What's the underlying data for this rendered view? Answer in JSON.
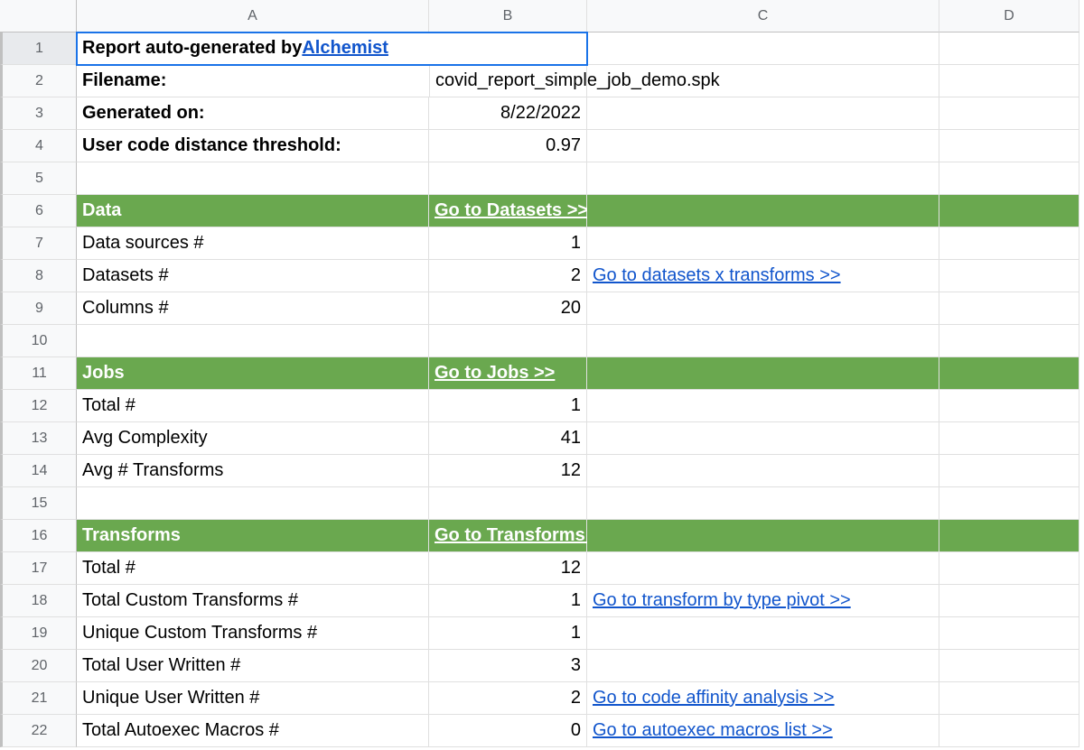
{
  "columns": [
    "A",
    "B",
    "C",
    "D"
  ],
  "row_numbers": [
    1,
    2,
    3,
    4,
    5,
    6,
    7,
    8,
    9,
    10,
    11,
    12,
    13,
    14,
    15,
    16,
    17,
    18,
    19,
    20,
    21,
    22
  ],
  "header": {
    "title_prefix": "Report auto-generated by ",
    "title_link": "Alchemist",
    "filename_label": "Filename:",
    "filename_value": "covid_report_simple_job_demo.spk",
    "generated_label": "Generated on:",
    "generated_value": "8/22/2022",
    "threshold_label": "User code distance threshold:",
    "threshold_value": "0.97"
  },
  "sections": {
    "data": {
      "title": "Data",
      "link": "Go to Datasets >>",
      "rows": [
        {
          "label": "Data sources #",
          "value": "1",
          "link": ""
        },
        {
          "label": "Datasets #",
          "value": "2",
          "link": "Go to datasets x transforms >>"
        },
        {
          "label": "Columns #",
          "value": "20",
          "link": ""
        }
      ]
    },
    "jobs": {
      "title": "Jobs",
      "link": "Go to Jobs >>",
      "rows": [
        {
          "label": "Total #",
          "value": "1",
          "link": ""
        },
        {
          "label": "Avg Complexity",
          "value": "41",
          "link": ""
        },
        {
          "label": "Avg # Transforms",
          "value": "12",
          "link": ""
        }
      ]
    },
    "transforms": {
      "title": "Transforms",
      "link": "Go to Transforms >>",
      "rows": [
        {
          "label": "Total #",
          "value": "12",
          "link": ""
        },
        {
          "label": "Total Custom Transforms #",
          "value": "1",
          "link": "Go to transform by type pivot >>"
        },
        {
          "label": "Unique Custom Transforms #",
          "value": "1",
          "link": ""
        },
        {
          "label": "Total User Written #",
          "value": "3",
          "link": ""
        },
        {
          "label": "Unique User Written #",
          "value": "2",
          "link": "Go to code affinity analysis >>"
        },
        {
          "label": "Total Autoexec Macros #",
          "value": "0",
          "link": "Go to autoexec macros list >>"
        }
      ]
    }
  }
}
